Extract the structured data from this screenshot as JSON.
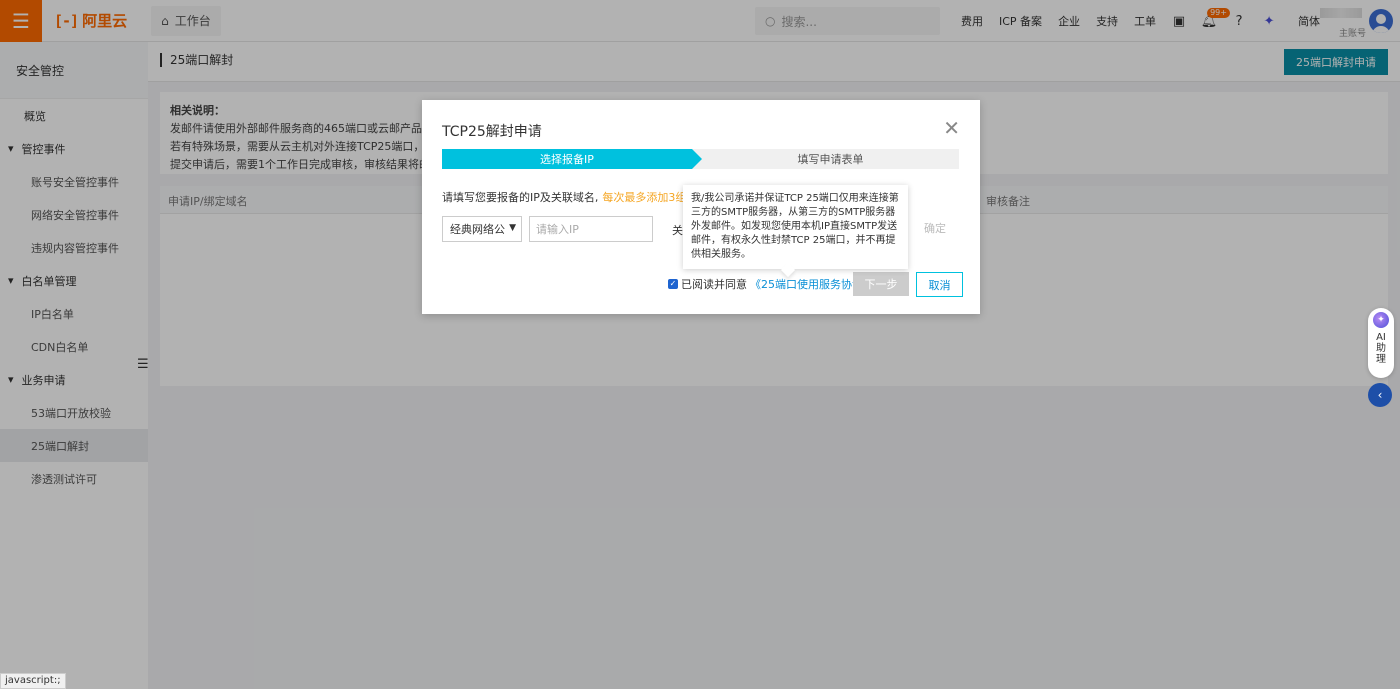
{
  "topbar": {
    "logo_text": "阿里云",
    "logo_mark": "[-]",
    "workbench_label": "工作台",
    "search_placeholder": "搜索...",
    "links": [
      "费用",
      "ICP 备案",
      "企业",
      "支持",
      "工单"
    ],
    "notification_badge": "99+",
    "language": "简体",
    "account_label": "主账号"
  },
  "sidebar": {
    "title": "安全管控",
    "items": [
      {
        "label": "概览",
        "level": "l1"
      },
      {
        "label": "管控事件",
        "level": "group"
      },
      {
        "label": "账号安全管控事件",
        "level": "l2"
      },
      {
        "label": "网络安全管控事件",
        "level": "l2"
      },
      {
        "label": "违规内容管控事件",
        "level": "l2"
      },
      {
        "label": "白名单管理",
        "level": "group"
      },
      {
        "label": "IP白名单",
        "level": "l2"
      },
      {
        "label": "CDN白名单",
        "level": "l2"
      },
      {
        "label": "业务申请",
        "level": "group"
      },
      {
        "label": "53端口开放校验",
        "level": "l2"
      },
      {
        "label": "25端口解封",
        "level": "l2",
        "active": true
      },
      {
        "label": "渗透测试许可",
        "level": "l2"
      }
    ]
  },
  "main": {
    "page_title": "25端口解封",
    "apply_button": "25端口解封申请",
    "notice_title": "相关说明：",
    "notice_lines": [
      "发邮件请使用外部邮件服务商的465端口或云邮产品。",
      "若有特殊场景，需要从云主机对外连接TCP25端口，请提交",
      "提交申请后，需要1个工作日完成审核，审核结果将邮件通"
    ],
    "table_headers": [
      "申请IP/绑定域名",
      "审核备注"
    ]
  },
  "modal": {
    "title": "TCP25解封申请",
    "close_symbol": "✕",
    "steps": [
      "选择报备IP",
      "填写申请表单"
    ],
    "tip_text": "请填写您要报备的IP及关联域名,",
    "tip_warning": "每次最多添加3组",
    "network_select": "经典网络公",
    "ip_placeholder": "请输入IP",
    "related_label": "关",
    "confirm_label": "确定",
    "agree_text": "已阅读并同意",
    "agreement_link": "《25端口使用服务协议》",
    "next_button": "下一步",
    "cancel_button": "取消"
  },
  "tooltip": {
    "text": "我/我公司承诺并保证TCP 25端口仅用来连接第三方的SMTP服务器，从第三方的SMTP服务器外发邮件。如发现您使用本机IP直接SMTP发送邮件，有权永久性封禁TCP 25端口，并不再提供相关服务。"
  },
  "floating": {
    "ai_label_1": "AI",
    "ai_label_2": "助",
    "ai_label_3": "理"
  },
  "status_bar": "javascript:;",
  "colors": {
    "brand_orange": "#ff6a00",
    "step_active": "#00c1de",
    "primary_button": "#0a8fa6",
    "link": "#0a8fd6",
    "warning": "#f5a623"
  }
}
